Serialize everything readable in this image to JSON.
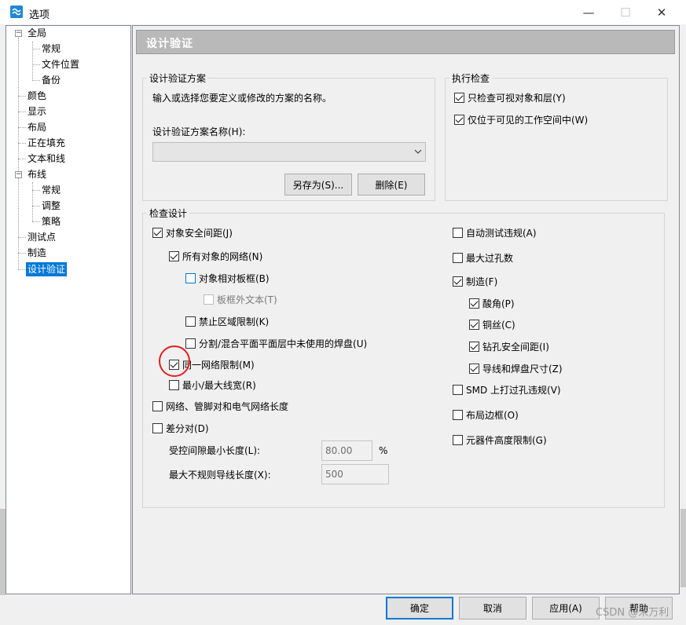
{
  "window": {
    "title": "选项",
    "minimize": "—",
    "maximize": "☐",
    "close": "✕"
  },
  "tree": {
    "items": [
      {
        "label": "全局",
        "expander": "−"
      },
      {
        "label": "常规"
      },
      {
        "label": "文件位置"
      },
      {
        "label": "备份"
      },
      {
        "label": "颜色"
      },
      {
        "label": "显示"
      },
      {
        "label": "布局"
      },
      {
        "label": "正在填充"
      },
      {
        "label": "文本和线"
      },
      {
        "label": "布线",
        "expander": "−"
      },
      {
        "label": "常规"
      },
      {
        "label": "调整"
      },
      {
        "label": "策略"
      },
      {
        "label": "测试点"
      },
      {
        "label": "制造"
      },
      {
        "label": "设计验证",
        "selected": true
      }
    ]
  },
  "panel": {
    "header": "设计验证",
    "scheme_group": {
      "title": "设计验证方案",
      "description": "输入或选择您要定义或修改的方案的名称。",
      "name_label": "设计验证方案名称(H):",
      "name_value": "",
      "save_as": "另存为(S)...",
      "delete": "删除(E)"
    },
    "exec_group": {
      "title": "执行检查",
      "items": [
        {
          "label": "只检查可视对象和层(Y)",
          "checked": true
        },
        {
          "label": "仅位于可见的工作空间中(W)",
          "checked": true
        }
      ]
    },
    "check_group": {
      "title": "检查设计",
      "left": [
        {
          "label": "对象安全间距(J)",
          "checked": true
        },
        {
          "label": "所有对象的网络(N)",
          "checked": true
        },
        {
          "label": "对象相对板框(B)",
          "checked": false
        },
        {
          "label": "板框外文本(T)",
          "checked": false,
          "disabled": true
        },
        {
          "label": "禁止区域限制(K)",
          "checked": false
        },
        {
          "label": "分割/混合平面平面层中未使用的焊盘(U)",
          "checked": false
        },
        {
          "label": "同一网络限制(M)",
          "checked": true
        },
        {
          "label": "最小/最大线宽(R)",
          "checked": false
        },
        {
          "label": "网络、管脚对和电气网络长度",
          "checked": false
        },
        {
          "label": "差分对(D)",
          "checked": false
        }
      ],
      "right": [
        {
          "label": "自动测试违规(A)",
          "checked": false
        },
        {
          "label": "最大过孔数",
          "checked": false
        },
        {
          "label": "制造(F)",
          "checked": true
        },
        {
          "label": "酸角(P)",
          "checked": true
        },
        {
          "label": "铜丝(C)",
          "checked": true
        },
        {
          "label": "钻孔安全间距(I)",
          "checked": true
        },
        {
          "label": "导线和焊盘尺寸(Z)",
          "checked": true
        },
        {
          "label": "SMD 上打过孔违规(V)",
          "checked": false
        },
        {
          "label": "布局边框(O)",
          "checked": false
        },
        {
          "label": "元器件高度限制(G)",
          "checked": false
        }
      ],
      "gap_label": "受控间隙最小长度(L):",
      "gap_value": "80.00",
      "gap_unit": "%",
      "irregular_label": "最大不规则导线长度(X):",
      "irregular_value": "500"
    }
  },
  "buttons": {
    "ok": "确定",
    "cancel": "取消",
    "apply": "应用(A)",
    "help": "帮助"
  },
  "watermark": "CSDN @米万利"
}
